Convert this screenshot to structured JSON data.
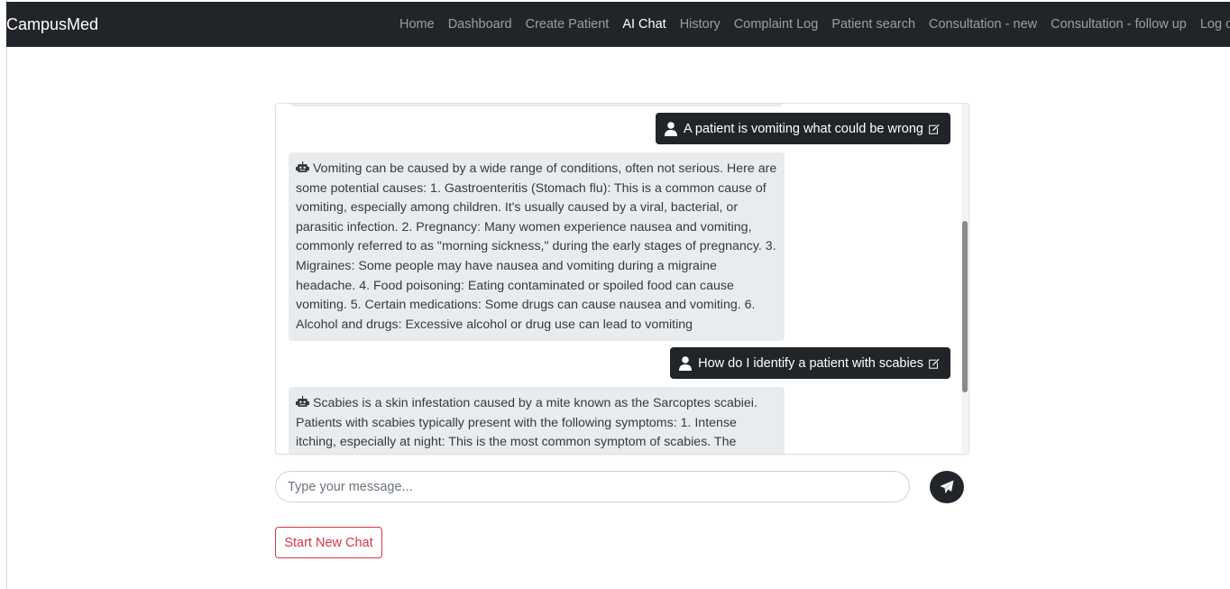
{
  "brand": "CampusMed",
  "nav": {
    "items": [
      "Home",
      "Dashboard",
      "Create Patient",
      "AI Chat",
      "History",
      "Complaint Log",
      "Patient search",
      "Consultation - new",
      "Consultation - follow up",
      "Log out"
    ],
    "active": "AI Chat"
  },
  "chat": {
    "messages": [
      {
        "role": "user",
        "text": "A patient is vomiting what could be wrong"
      },
      {
        "role": "bot",
        "text": "Vomiting can be caused by a wide range of conditions, often not serious. Here are some potential causes: 1. Gastroenteritis (Stomach flu): This is a common cause of vomiting, especially among children. It's usually caused by a viral, bacterial, or parasitic infection. 2. Pregnancy: Many women experience nausea and vomiting, commonly referred to as \"morning sickness,\" during the early stages of pregnancy. 3. Migraines: Some people may have nausea and vomiting during a migraine headache. 4. Food poisoning: Eating contaminated or spoiled food can cause vomiting. 5. Certain medications: Some drugs can cause nausea and vomiting. 6. Alcohol and drugs: Excessive alcohol or drug use can lead to vomiting"
      },
      {
        "role": "user",
        "text": "How do I identify a patient with scabies"
      },
      {
        "role": "bot",
        "text": "Scabies is a skin infestation caused by a mite known as the Sarcoptes scabiei. Patients with scabies typically present with the following symptoms: 1. Intense itching, especially at night: This is the most common symptom of scabies. The"
      }
    ]
  },
  "input": {
    "placeholder": "Type your message...",
    "value": ""
  },
  "buttons": {
    "new_chat": "Start New Chat"
  },
  "icons": {
    "user": "user-icon",
    "bot": "robot-icon",
    "edit": "edit-icon",
    "send": "paper-plane-icon"
  },
  "colors": {
    "navbar": "#212529",
    "user_bubble": "#212529",
    "bot_bubble": "#e9ecef",
    "danger": "#dc3545"
  }
}
